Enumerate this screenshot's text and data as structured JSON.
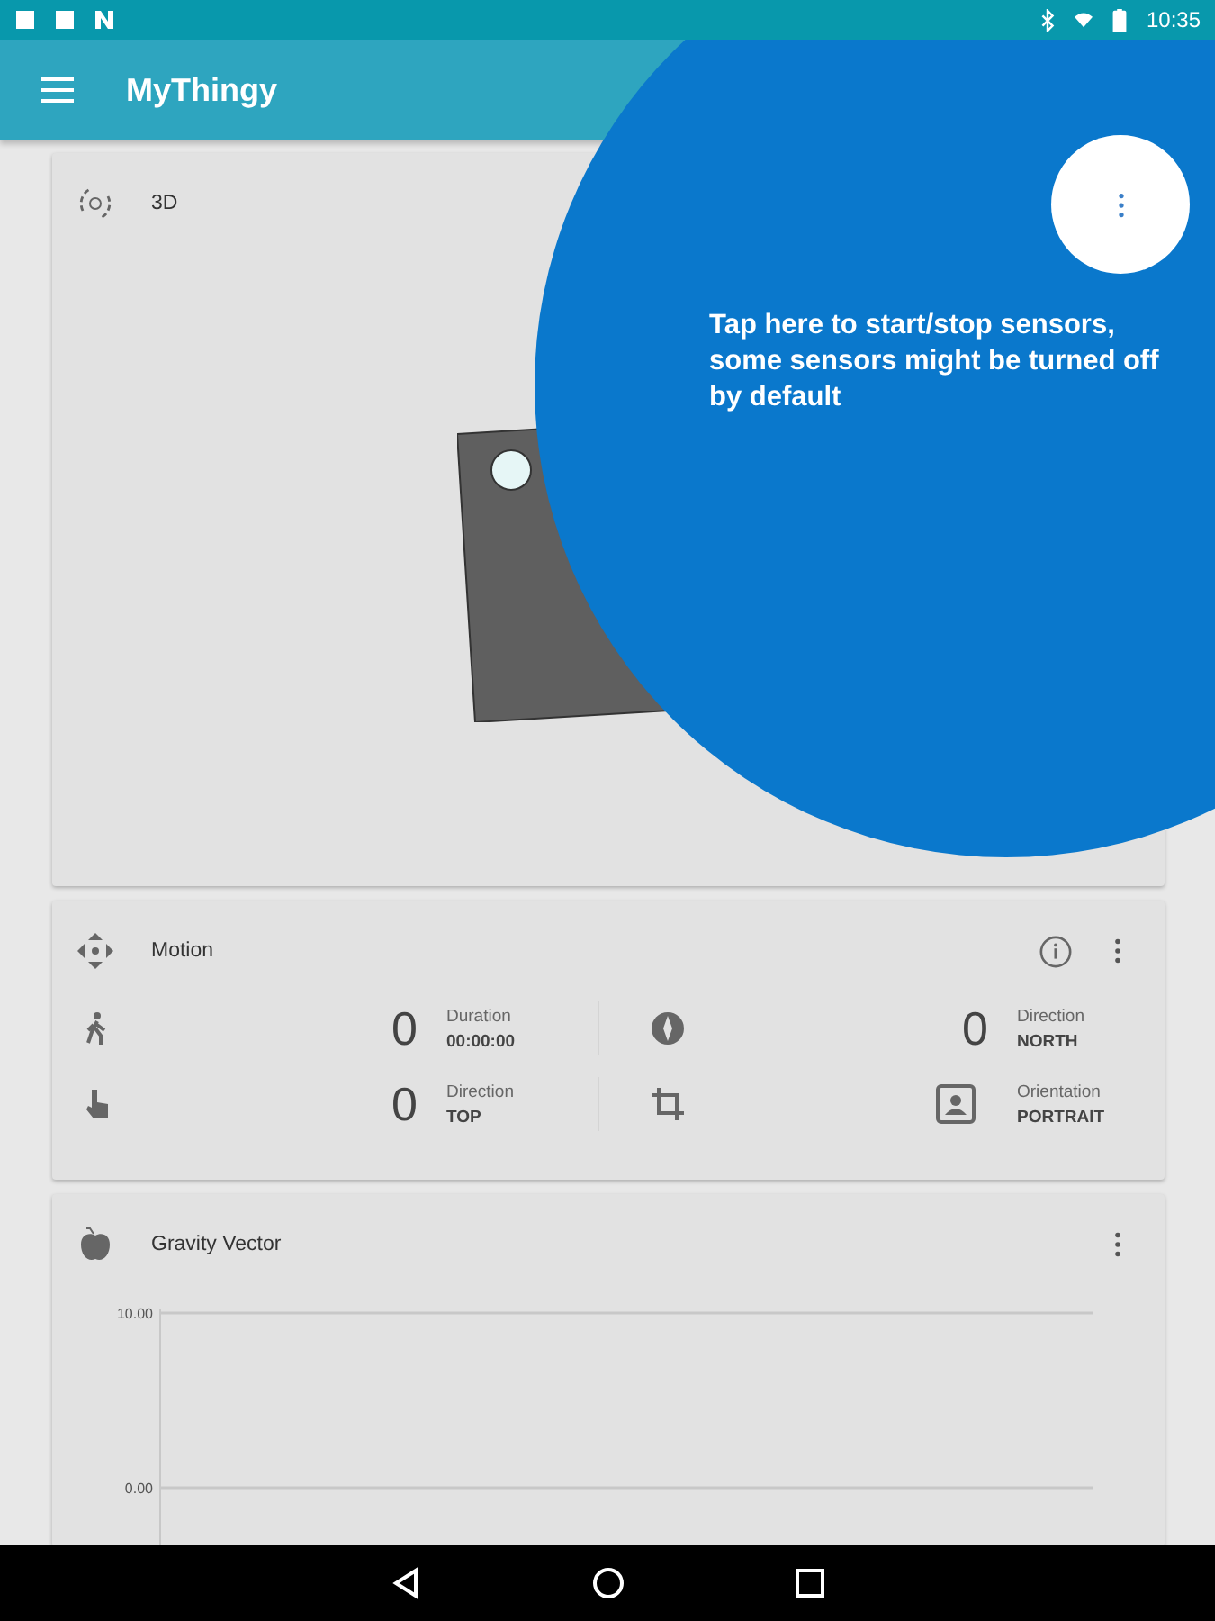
{
  "status_bar": {
    "time": "10:35"
  },
  "toolbar": {
    "title": "MyThingy"
  },
  "cards": [
    {
      "title": "3D"
    },
    {
      "title": "Motion",
      "cells": [
        {
          "kind": "count",
          "value": "0",
          "label": "Duration",
          "reading": "00:00:00"
        },
        {
          "kind": "count",
          "value": "0",
          "label": "Direction",
          "reading": "NORTH"
        },
        {
          "kind": "count",
          "value": "0",
          "label": "Direction",
          "reading": "TOP"
        },
        {
          "kind": "icon",
          "label": "Orientation",
          "reading": "PORTRAIT"
        }
      ]
    },
    {
      "title": "Gravity Vector",
      "plot": {
        "y_labels": [
          "10.00",
          "0.00"
        ]
      }
    }
  ],
  "tooltip": {
    "text": "Tap here to start/stop sensors, some sensors might be turned off by default"
  }
}
